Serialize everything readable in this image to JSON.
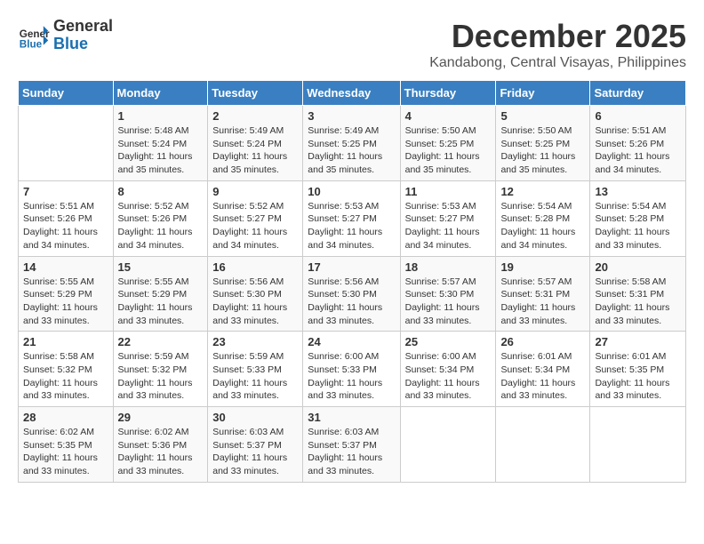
{
  "header": {
    "logo_line1": "General",
    "logo_line2": "Blue",
    "month_year": "December 2025",
    "location": "Kandabong, Central Visayas, Philippines"
  },
  "days_of_week": [
    "Sunday",
    "Monday",
    "Tuesday",
    "Wednesday",
    "Thursday",
    "Friday",
    "Saturday"
  ],
  "weeks": [
    [
      {
        "day": "",
        "info": ""
      },
      {
        "day": "1",
        "info": "Sunrise: 5:48 AM\nSunset: 5:24 PM\nDaylight: 11 hours\nand 35 minutes."
      },
      {
        "day": "2",
        "info": "Sunrise: 5:49 AM\nSunset: 5:24 PM\nDaylight: 11 hours\nand 35 minutes."
      },
      {
        "day": "3",
        "info": "Sunrise: 5:49 AM\nSunset: 5:25 PM\nDaylight: 11 hours\nand 35 minutes."
      },
      {
        "day": "4",
        "info": "Sunrise: 5:50 AM\nSunset: 5:25 PM\nDaylight: 11 hours\nand 35 minutes."
      },
      {
        "day": "5",
        "info": "Sunrise: 5:50 AM\nSunset: 5:25 PM\nDaylight: 11 hours\nand 35 minutes."
      },
      {
        "day": "6",
        "info": "Sunrise: 5:51 AM\nSunset: 5:26 PM\nDaylight: 11 hours\nand 34 minutes."
      }
    ],
    [
      {
        "day": "7",
        "info": "Sunrise: 5:51 AM\nSunset: 5:26 PM\nDaylight: 11 hours\nand 34 minutes."
      },
      {
        "day": "8",
        "info": "Sunrise: 5:52 AM\nSunset: 5:26 PM\nDaylight: 11 hours\nand 34 minutes."
      },
      {
        "day": "9",
        "info": "Sunrise: 5:52 AM\nSunset: 5:27 PM\nDaylight: 11 hours\nand 34 minutes."
      },
      {
        "day": "10",
        "info": "Sunrise: 5:53 AM\nSunset: 5:27 PM\nDaylight: 11 hours\nand 34 minutes."
      },
      {
        "day": "11",
        "info": "Sunrise: 5:53 AM\nSunset: 5:27 PM\nDaylight: 11 hours\nand 34 minutes."
      },
      {
        "day": "12",
        "info": "Sunrise: 5:54 AM\nSunset: 5:28 PM\nDaylight: 11 hours\nand 34 minutes."
      },
      {
        "day": "13",
        "info": "Sunrise: 5:54 AM\nSunset: 5:28 PM\nDaylight: 11 hours\nand 33 minutes."
      }
    ],
    [
      {
        "day": "14",
        "info": "Sunrise: 5:55 AM\nSunset: 5:29 PM\nDaylight: 11 hours\nand 33 minutes."
      },
      {
        "day": "15",
        "info": "Sunrise: 5:55 AM\nSunset: 5:29 PM\nDaylight: 11 hours\nand 33 minutes."
      },
      {
        "day": "16",
        "info": "Sunrise: 5:56 AM\nSunset: 5:30 PM\nDaylight: 11 hours\nand 33 minutes."
      },
      {
        "day": "17",
        "info": "Sunrise: 5:56 AM\nSunset: 5:30 PM\nDaylight: 11 hours\nand 33 minutes."
      },
      {
        "day": "18",
        "info": "Sunrise: 5:57 AM\nSunset: 5:30 PM\nDaylight: 11 hours\nand 33 minutes."
      },
      {
        "day": "19",
        "info": "Sunrise: 5:57 AM\nSunset: 5:31 PM\nDaylight: 11 hours\nand 33 minutes."
      },
      {
        "day": "20",
        "info": "Sunrise: 5:58 AM\nSunset: 5:31 PM\nDaylight: 11 hours\nand 33 minutes."
      }
    ],
    [
      {
        "day": "21",
        "info": "Sunrise: 5:58 AM\nSunset: 5:32 PM\nDaylight: 11 hours\nand 33 minutes."
      },
      {
        "day": "22",
        "info": "Sunrise: 5:59 AM\nSunset: 5:32 PM\nDaylight: 11 hours\nand 33 minutes."
      },
      {
        "day": "23",
        "info": "Sunrise: 5:59 AM\nSunset: 5:33 PM\nDaylight: 11 hours\nand 33 minutes."
      },
      {
        "day": "24",
        "info": "Sunrise: 6:00 AM\nSunset: 5:33 PM\nDaylight: 11 hours\nand 33 minutes."
      },
      {
        "day": "25",
        "info": "Sunrise: 6:00 AM\nSunset: 5:34 PM\nDaylight: 11 hours\nand 33 minutes."
      },
      {
        "day": "26",
        "info": "Sunrise: 6:01 AM\nSunset: 5:34 PM\nDaylight: 11 hours\nand 33 minutes."
      },
      {
        "day": "27",
        "info": "Sunrise: 6:01 AM\nSunset: 5:35 PM\nDaylight: 11 hours\nand 33 minutes."
      }
    ],
    [
      {
        "day": "28",
        "info": "Sunrise: 6:02 AM\nSunset: 5:35 PM\nDaylight: 11 hours\nand 33 minutes."
      },
      {
        "day": "29",
        "info": "Sunrise: 6:02 AM\nSunset: 5:36 PM\nDaylight: 11 hours\nand 33 minutes."
      },
      {
        "day": "30",
        "info": "Sunrise: 6:03 AM\nSunset: 5:37 PM\nDaylight: 11 hours\nand 33 minutes."
      },
      {
        "day": "31",
        "info": "Sunrise: 6:03 AM\nSunset: 5:37 PM\nDaylight: 11 hours\nand 33 minutes."
      },
      {
        "day": "",
        "info": ""
      },
      {
        "day": "",
        "info": ""
      },
      {
        "day": "",
        "info": ""
      }
    ]
  ]
}
